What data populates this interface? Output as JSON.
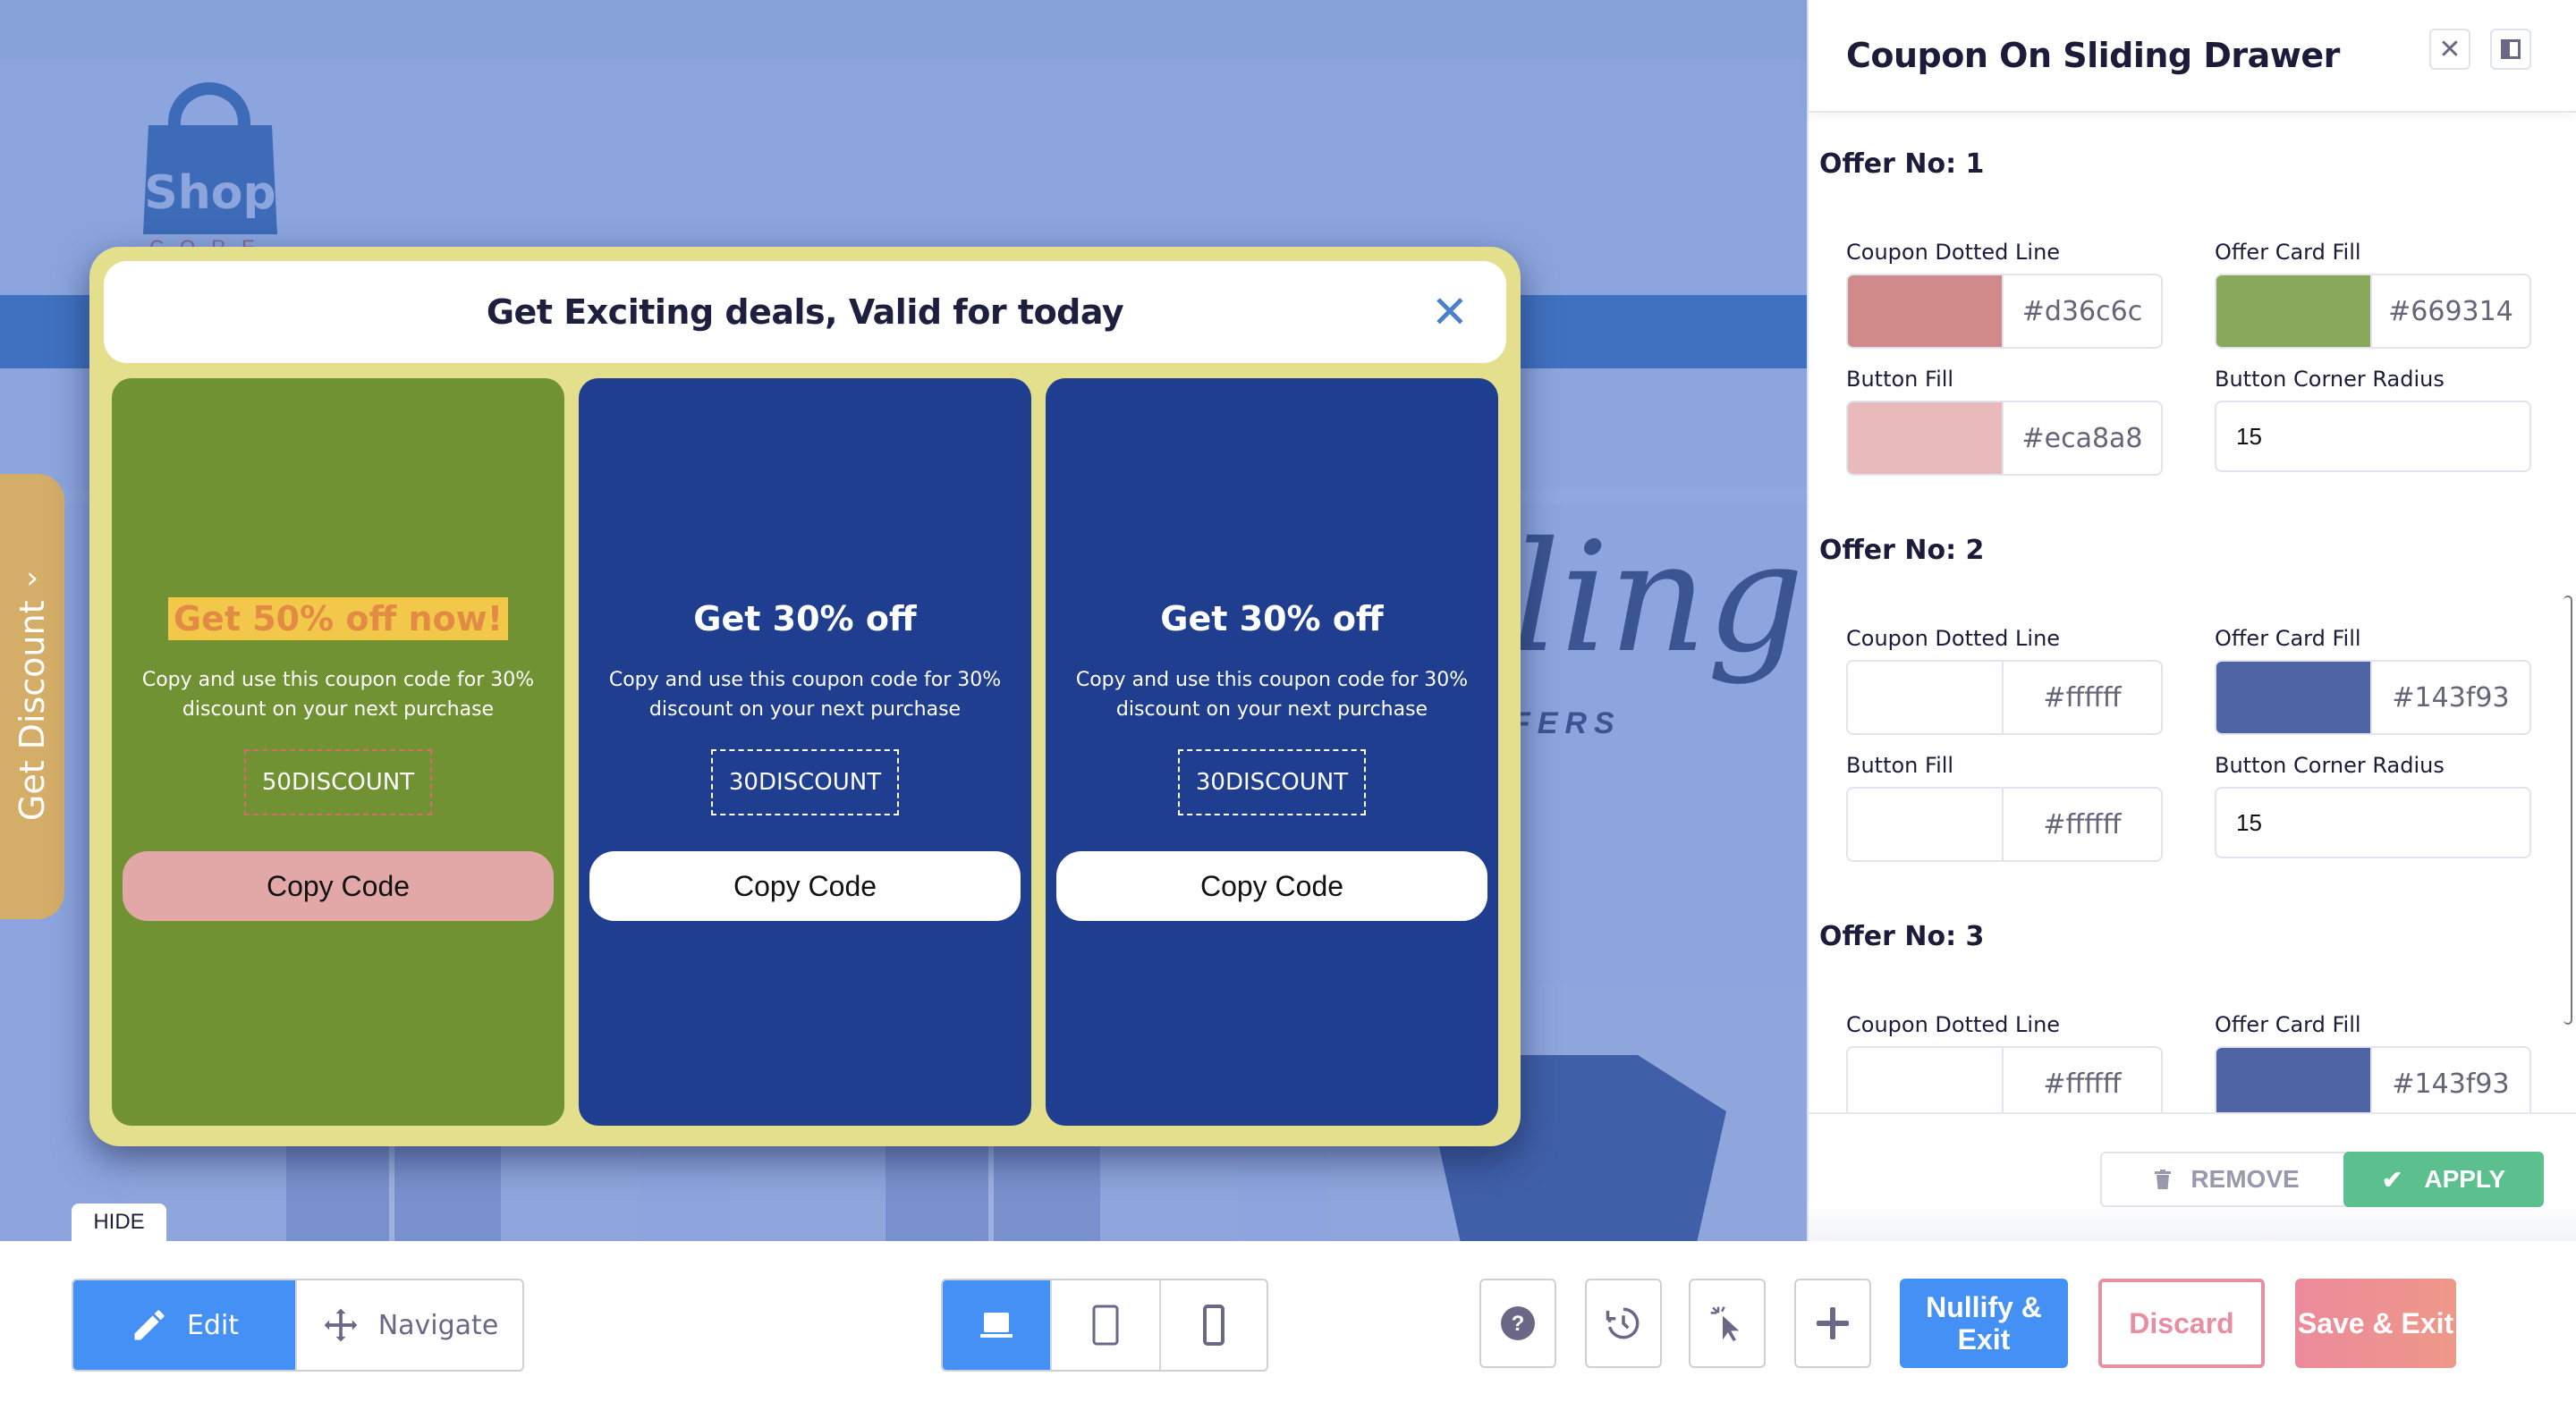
{
  "site_preview": {
    "logo_text": "Shop",
    "logo_subtext": "CORE",
    "script_text": "ling",
    "offers_text": "FERS",
    "side_tab_label": "Get Discount",
    "hide_label": "HIDE"
  },
  "popup": {
    "title": "Get Exciting deals, Valid for today",
    "close_glyph": "✕",
    "border_color": "#e3df8d",
    "offers": [
      {
        "title": "Get 50% off now!",
        "description": "Copy and use this coupon code for 30% discount on your next purchase",
        "code": "50DISCOUNT",
        "button_label": "Copy Code",
        "card_fill": "#719233",
        "dotted_line": "#d36c6c",
        "button_fill": "#e2a8a8",
        "title_highlight": true
      },
      {
        "title": "Get 30% off",
        "description": "Copy and use this coupon code for 30% discount on your next purchase",
        "code": "30DISCOUNT",
        "button_label": "Copy Code",
        "card_fill": "#1f3e8f",
        "dotted_line": "#ffffff",
        "button_fill": "#ffffff",
        "title_highlight": false
      },
      {
        "title": "Get 30% off",
        "description": "Copy and use this coupon code for 30% discount on your next purchase",
        "code": "30DISCOUNT",
        "button_label": "Copy Code",
        "card_fill": "#1f3e8f",
        "dotted_line": "#ffffff",
        "button_fill": "#ffffff",
        "title_highlight": false
      }
    ]
  },
  "panel": {
    "title": "Coupon On Sliding Drawer",
    "offers": [
      {
        "heading": "Offer No: 1",
        "coupon_dotted_line": {
          "label": "Coupon Dotted Line",
          "value": "#d36c6c",
          "swatch": "#d08a8a"
        },
        "offer_card_fill": {
          "label": "Offer Card Fill",
          "value": "#669314",
          "swatch": "#8aa85c"
        },
        "button_fill": {
          "label": "Button Fill",
          "value": "#eca8a8",
          "swatch": "#e8baba"
        },
        "button_corner_radius": {
          "label": "Button Corner Radius",
          "value": "15"
        }
      },
      {
        "heading": "Offer No: 2",
        "coupon_dotted_line": {
          "label": "Coupon Dotted Line",
          "value": "#ffffff",
          "swatch": "#ffffff"
        },
        "offer_card_fill": {
          "label": "Offer Card Fill",
          "value": "#143f93",
          "swatch": "#4e64a4"
        },
        "button_fill": {
          "label": "Button Fill",
          "value": "#ffffff",
          "swatch": "#ffffff"
        },
        "button_corner_radius": {
          "label": "Button Corner Radius",
          "value": "15"
        }
      },
      {
        "heading": "Offer No: 3",
        "coupon_dotted_line": {
          "label": "Coupon Dotted Line",
          "value": "#ffffff",
          "swatch": "#ffffff"
        },
        "offer_card_fill": {
          "label": "Offer Card Fill",
          "value": "#143f93",
          "swatch": "#4e64a4"
        }
      }
    ],
    "remove_label": "REMOVE",
    "apply_label": "APPLY"
  },
  "toolbar": {
    "edit_label": "Edit",
    "navigate_label": "Navigate",
    "devices": [
      "desktop",
      "tablet",
      "mobile"
    ],
    "active_device": "desktop",
    "nullify_label": "Nullify & Exit",
    "discard_label": "Discard",
    "save_label": "Save & Exit",
    "accent": "#4590f4",
    "discard_color": "#e78ea0"
  }
}
